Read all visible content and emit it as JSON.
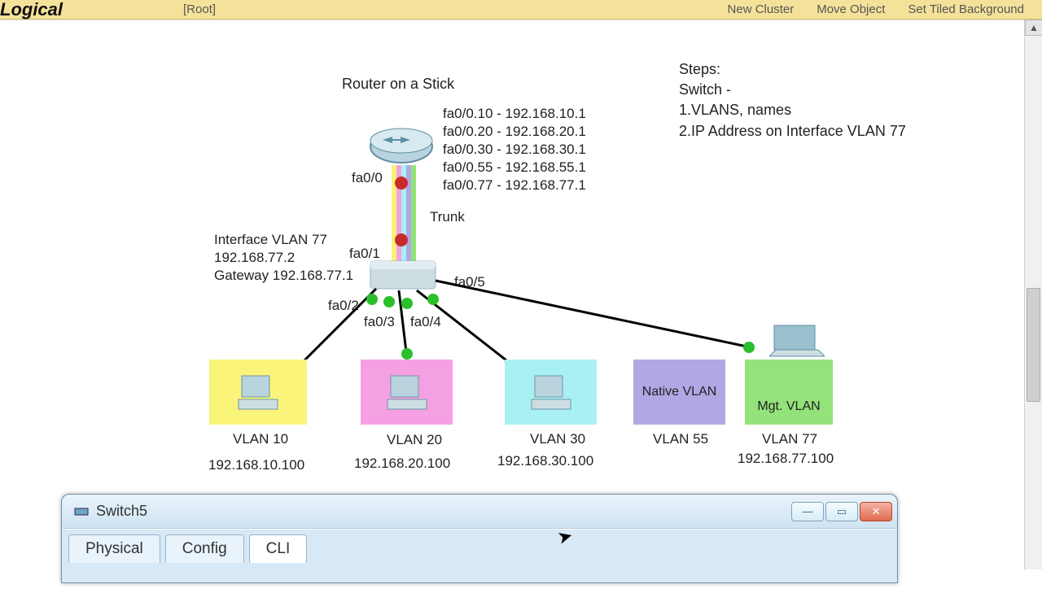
{
  "toolbar": {
    "logo": "Logical",
    "root": "[Root]",
    "new_cluster": "New Cluster",
    "move_object": "Move Object",
    "set_bg": "Set Tiled Background"
  },
  "diagram": {
    "title": "Router on a Stick",
    "router_port": "fa0/0",
    "trunk_label": "Trunk",
    "switch_port_top": "fa0/1",
    "switch_ports": {
      "p2": "fa0/2",
      "p3": "fa0/3",
      "p4": "fa0/4",
      "p5": "fa0/5"
    },
    "subifs": [
      "fa0/0.10 - 192.168.10.1",
      "fa0/0.20 - 192.168.20.1",
      "fa0/0.30 - 192.168.30.1",
      "fa0/0.55 - 192.168.55.1",
      "fa0/0.77 - 192.168.77.1"
    ],
    "svi": {
      "line1": "Interface VLAN 77",
      "line2": "192.168.77.2",
      "line3": "Gateway 192.168.77.1"
    },
    "notes": {
      "h": "Steps:",
      "l1": "Switch -",
      "l2": "1.VLANS, names",
      "l3": "2.IP Address on Interface VLAN 77"
    },
    "hosts": {
      "vlan10": {
        "name": "VLAN 10",
        "ip": "192.168.10.100"
      },
      "vlan20": {
        "name": "VLAN 20",
        "ip": "192.168.20.100"
      },
      "vlan30": {
        "name": "VLAN 30",
        "ip": "192.168.30.100"
      },
      "vlan55": {
        "name": "VLAN 55",
        "box": "Native VLAN"
      },
      "vlan77": {
        "name": "VLAN 77",
        "ip": "192.168.77.100",
        "box": "Mgt. VLAN"
      }
    }
  },
  "switch_window": {
    "title": "Switch5",
    "tabs": {
      "physical": "Physical",
      "config": "Config",
      "cli": "CLI"
    }
  }
}
